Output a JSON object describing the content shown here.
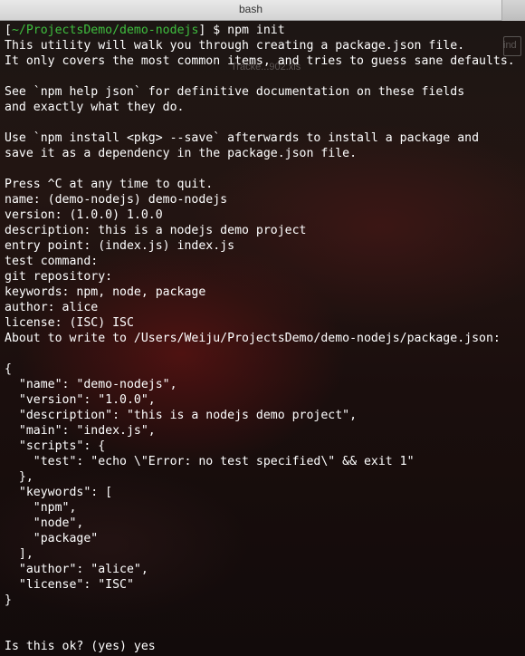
{
  "window": {
    "title": "bash"
  },
  "background": {
    "ghost_label_right": "ind",
    "ghost_label_center": "Tracke...902.xls"
  },
  "terminal": {
    "prompt_open": "[",
    "prompt_path": "~/ProjectsDemo/demo-nodejs",
    "prompt_close": "]",
    "prompt_command": " $ npm init",
    "lines": [
      "This utility will walk you through creating a package.json file.",
      "It only covers the most common items, and tries to guess sane defaults.",
      "",
      "See `npm help json` for definitive documentation on these fields",
      "and exactly what they do.",
      "",
      "Use `npm install <pkg> --save` afterwards to install a package and",
      "save it as a dependency in the package.json file.",
      "",
      "Press ^C at any time to quit.",
      "name: (demo-nodejs) demo-nodejs",
      "version: (1.0.0) 1.0.0",
      "description: this is a nodejs demo project",
      "entry point: (index.js) index.js",
      "test command:",
      "git repository:",
      "keywords: npm, node, package",
      "author: alice",
      "license: (ISC) ISC",
      "About to write to /Users/Weiju/ProjectsDemo/demo-nodejs/package.json:",
      "",
      "{",
      "  \"name\": \"demo-nodejs\",",
      "  \"version\": \"1.0.0\",",
      "  \"description\": \"this is a nodejs demo project\",",
      "  \"main\": \"index.js\",",
      "  \"scripts\": {",
      "    \"test\": \"echo \\\"Error: no test specified\\\" && exit 1\"",
      "  },",
      "  \"keywords\": [",
      "    \"npm\",",
      "    \"node\",",
      "    \"package\"",
      "  ],",
      "  \"author\": \"alice\",",
      "  \"license\": \"ISC\"",
      "}",
      "",
      "",
      "Is this ok? (yes) yes"
    ]
  }
}
